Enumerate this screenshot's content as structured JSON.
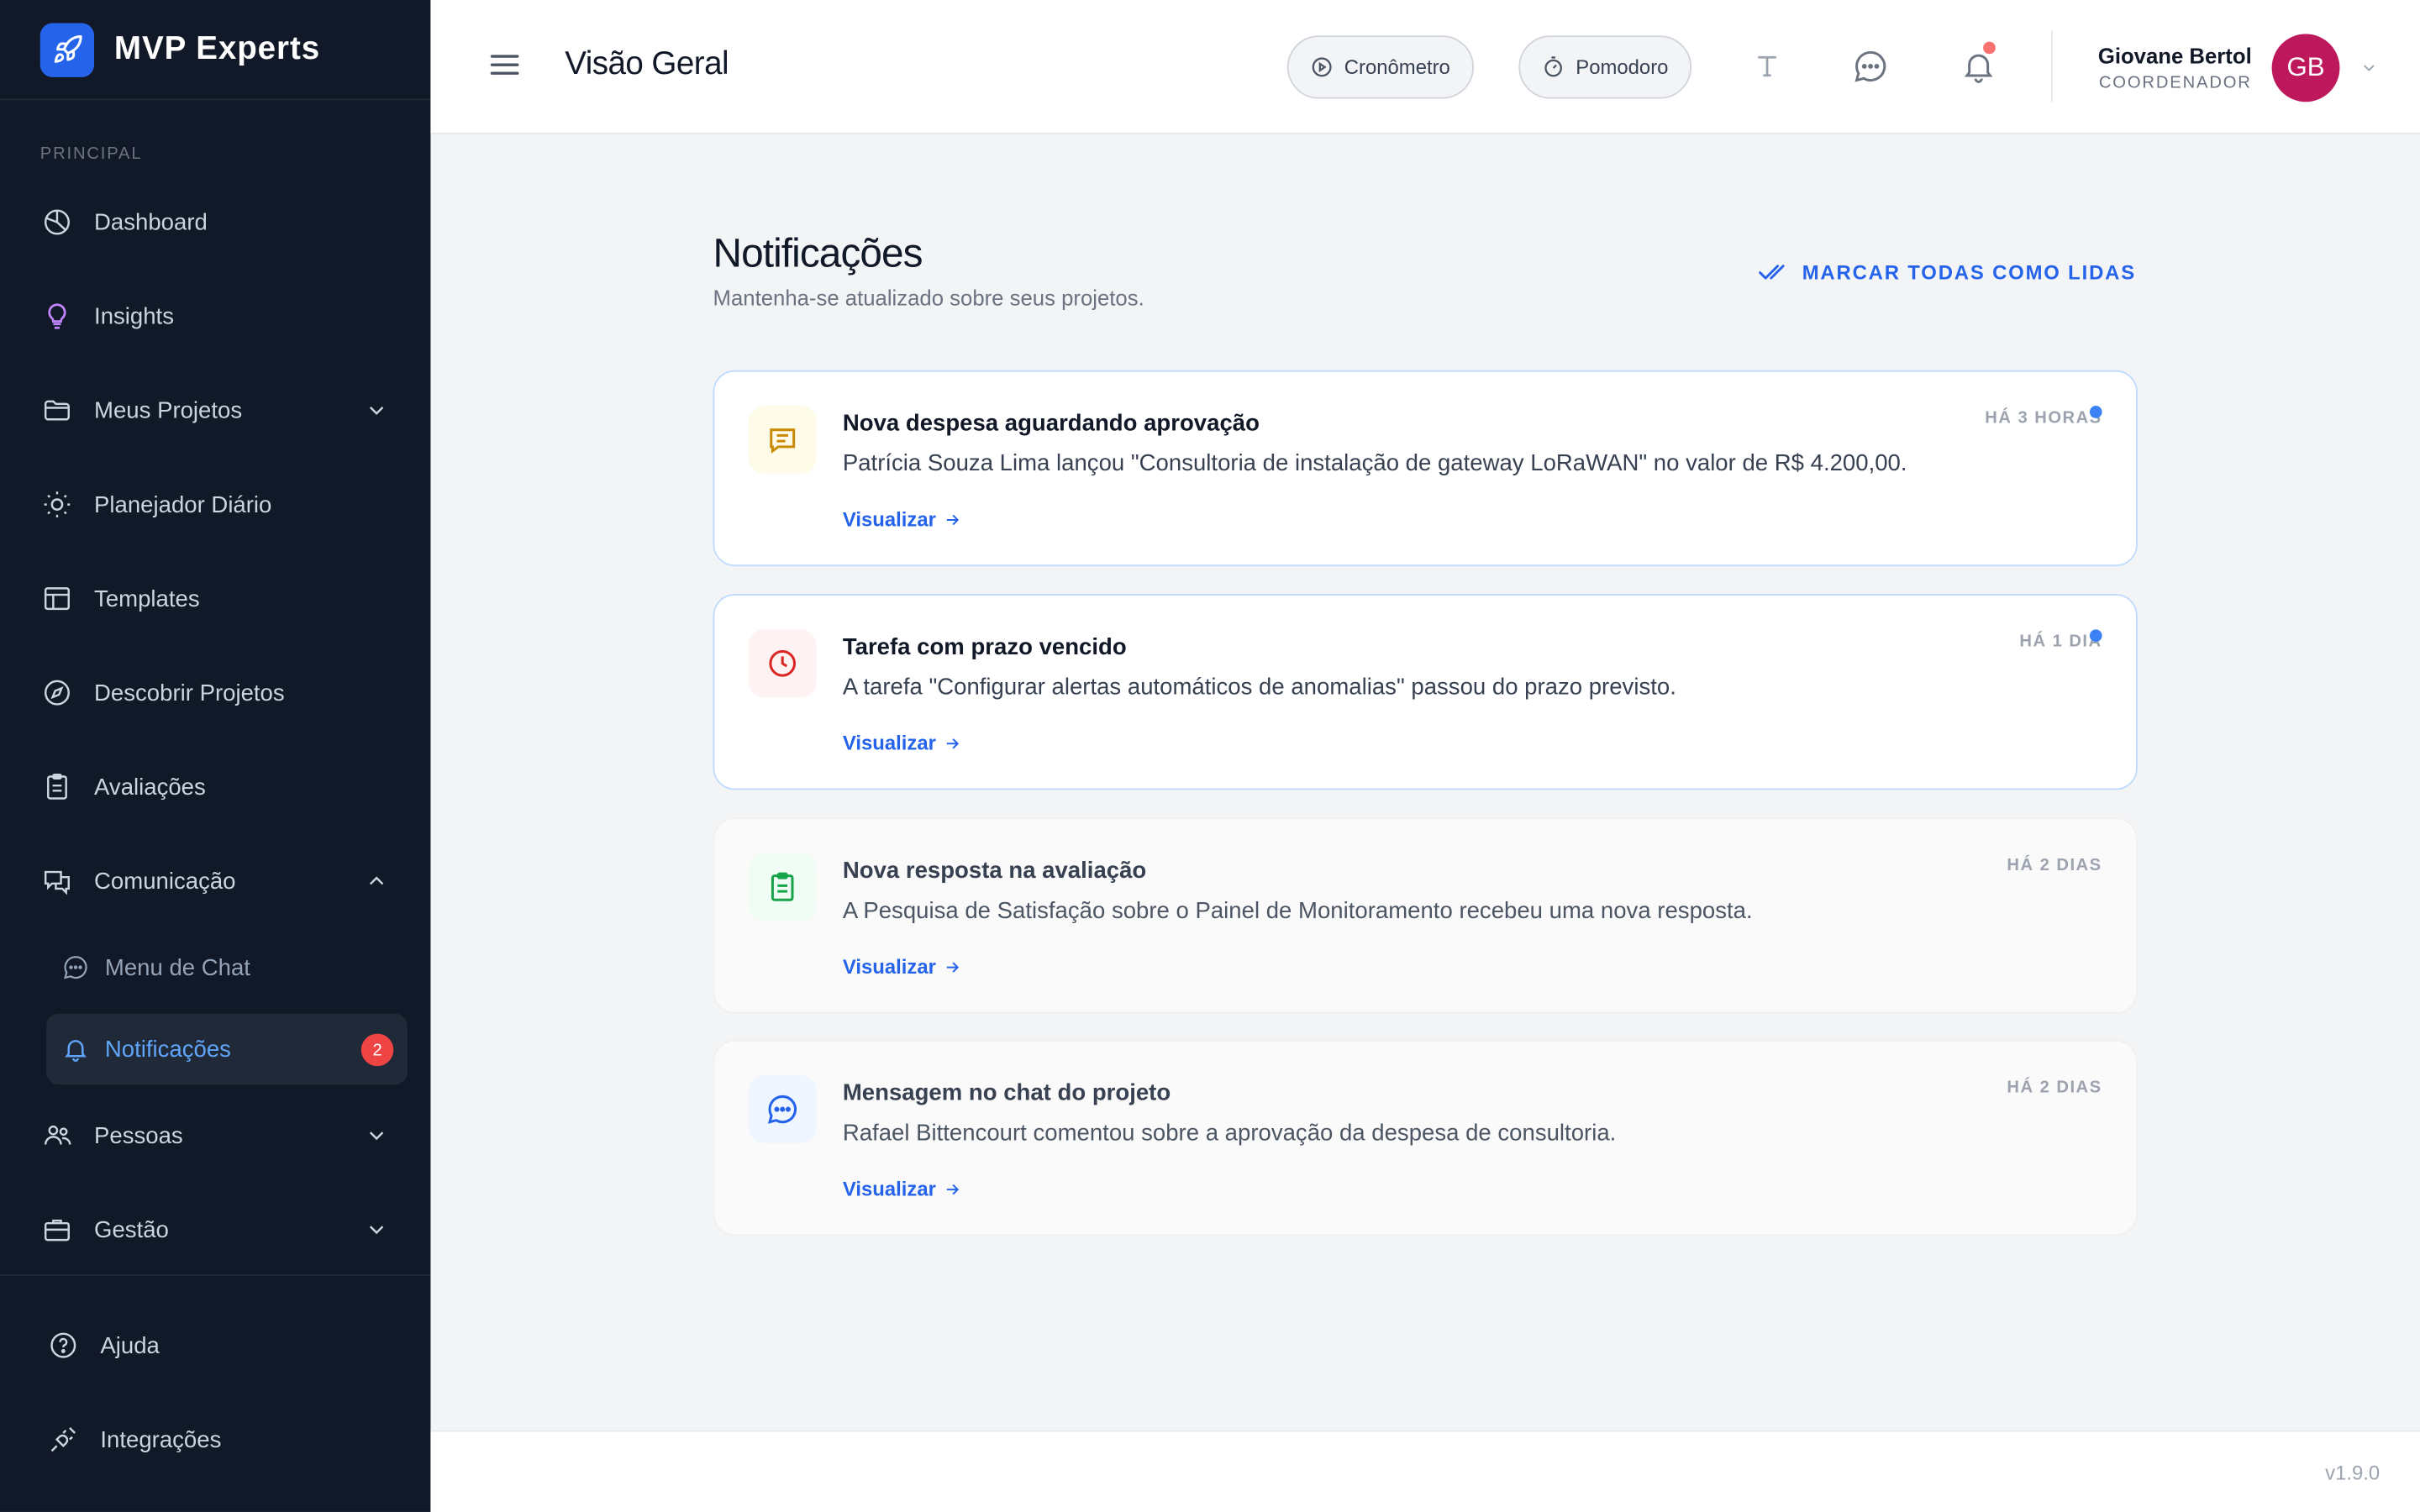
{
  "brand": {
    "name": "MVP Experts"
  },
  "sidebar": {
    "section_label": "PRINCIPAL",
    "items": [
      {
        "label": "Dashboard",
        "icon": "chart-pie-icon"
      },
      {
        "label": "Insights",
        "icon": "lightbulb-icon",
        "accent": "#c084fc"
      },
      {
        "label": "Meus Projetos",
        "icon": "folder-icon",
        "expandable": true,
        "expanded": false
      },
      {
        "label": "Planejador Diário",
        "icon": "sun-icon"
      },
      {
        "label": "Templates",
        "icon": "layout-icon"
      },
      {
        "label": "Descobrir Projetos",
        "icon": "compass-icon"
      },
      {
        "label": "Avaliações",
        "icon": "clipboard-icon"
      },
      {
        "label": "Comunicação",
        "icon": "chat-bubbles-icon",
        "expandable": true,
        "expanded": true
      }
    ],
    "sub_items": [
      {
        "label": "Menu de Chat",
        "icon": "chat-icon",
        "active": false
      },
      {
        "label": "Notificações",
        "icon": "bell-icon",
        "active": true,
        "badge": "2"
      }
    ],
    "items_after": [
      {
        "label": "Pessoas",
        "icon": "users-icon",
        "expandable": true,
        "expanded": false
      },
      {
        "label": "Gestão",
        "icon": "briefcase-icon",
        "expandable": true,
        "expanded": false
      }
    ],
    "bottom_items": [
      {
        "label": "Ajuda",
        "icon": "help-circle-icon"
      },
      {
        "label": "Integrações",
        "icon": "plug-icon"
      }
    ]
  },
  "header": {
    "title": "Visão Geral",
    "timer_label": "Cronômetro",
    "pomodoro_label": "Pomodoro",
    "user": {
      "name": "Giovane Bertol",
      "role": "COORDENADOR",
      "initials": "GB",
      "avatar_color": "#be185d"
    }
  },
  "main": {
    "title": "Notificações",
    "subtitle": "Mantenha-se atualizado sobre seus projetos.",
    "mark_all_label": "MARCAR TODAS COMO LIDAS",
    "notifications": [
      {
        "title": "Nova despesa aguardando aprovação",
        "body": "Patrícia Souza Lima lançou \"Consultoria de instalação de gateway LoRaWAN\" no valor de R$ 4.200,00.",
        "time": "HÁ 3 HORAS",
        "link_label": "Visualizar",
        "unread": true,
        "icon": "receipt-icon",
        "icon_color": "#ca8a04",
        "icon_bg": "#fefce8"
      },
      {
        "title": "Tarefa com prazo vencido",
        "body": "A tarefa \"Configurar alertas automáticos de anomalias\" passou do prazo previsto.",
        "time": "HÁ 1 DIA",
        "link_label": "Visualizar",
        "unread": true,
        "icon": "clock-icon",
        "icon_color": "#dc2626",
        "icon_bg": "#fef2f2"
      },
      {
        "title": "Nova resposta na avaliação",
        "body": "A Pesquisa de Satisfação sobre o Painel de Monitoramento recebeu uma nova resposta.",
        "time": "HÁ 2 DIAS",
        "link_label": "Visualizar",
        "unread": false,
        "icon": "clipboard-check-icon",
        "icon_color": "#16a34a",
        "icon_bg": "#f0fdf4"
      },
      {
        "title": "Mensagem no chat do projeto",
        "body": "Rafael Bittencourt comentou sobre a aprovação da despesa de consultoria.",
        "time": "HÁ 2 DIAS",
        "link_label": "Visualizar",
        "unread": false,
        "icon": "chat-icon",
        "icon_color": "#2563eb",
        "icon_bg": "#eff6ff"
      }
    ]
  },
  "footer": {
    "version": "v1.9.0"
  },
  "colors": {
    "accent": "#2563eb",
    "sidebar_bg": "#111827",
    "badge": "#ef4444"
  }
}
